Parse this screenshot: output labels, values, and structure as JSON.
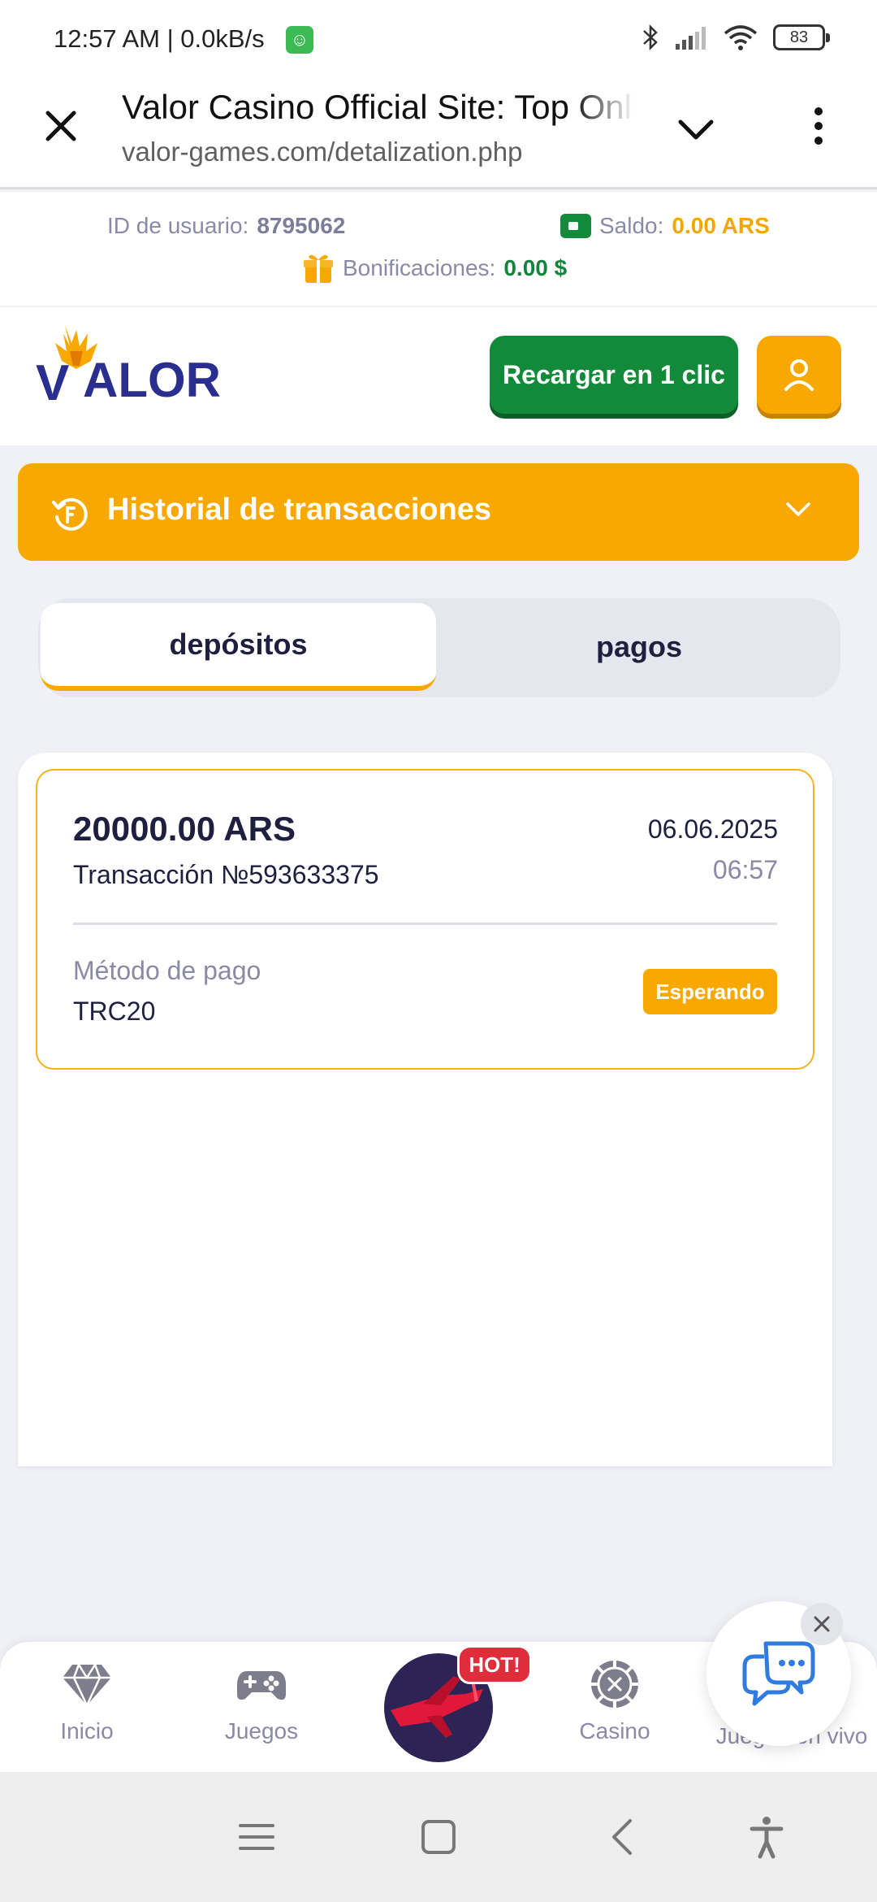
{
  "status_bar": {
    "time": "12:57 AM | 0.0kB/s",
    "battery": "83",
    "icons": [
      "bluetooth-icon",
      "signal-icon",
      "wifi-icon",
      "battery-icon"
    ]
  },
  "browser": {
    "title": "Valor Casino Official Site: Top Online",
    "url": "valor-games.com/detalization.php"
  },
  "user": {
    "id_label": "ID de usuario:",
    "id_value": "8795062",
    "saldo_label": "Saldo:",
    "saldo_value": "0.00 ARS",
    "bonus_label": "Bonificaciones:",
    "bonus_value": "0.00 $"
  },
  "header": {
    "logo_text": "VALOR",
    "recargar_label": "Recargar en 1 clic"
  },
  "history": {
    "title": "Historial de transacciones"
  },
  "tabs": [
    {
      "label": "depósitos",
      "active": true
    },
    {
      "label": "pagos",
      "active": false
    }
  ],
  "transactions": [
    {
      "amount": "20000.00 ARS",
      "number": "Transacción №593633375",
      "date": "06.06.2025",
      "time": "06:57",
      "method_label": "Método de pago",
      "method": "TRC20",
      "status": "Esperando"
    }
  ],
  "bottom_nav": {
    "items": [
      {
        "label": "Inicio",
        "icon": "diamond-icon"
      },
      {
        "label": "Juegos",
        "icon": "gamepad-icon"
      },
      {
        "label": "Casino",
        "icon": "casino-chip-icon"
      },
      {
        "label": "Juegos en vivo",
        "icon": "live-icon"
      }
    ],
    "hot_badge": "HOT!"
  },
  "colors": {
    "accent_orange": "#f9a800",
    "accent_green": "#138a3a",
    "text_dark": "#1f2040",
    "text_muted": "#8a8aa6",
    "hot_red": "#e02d3c"
  }
}
